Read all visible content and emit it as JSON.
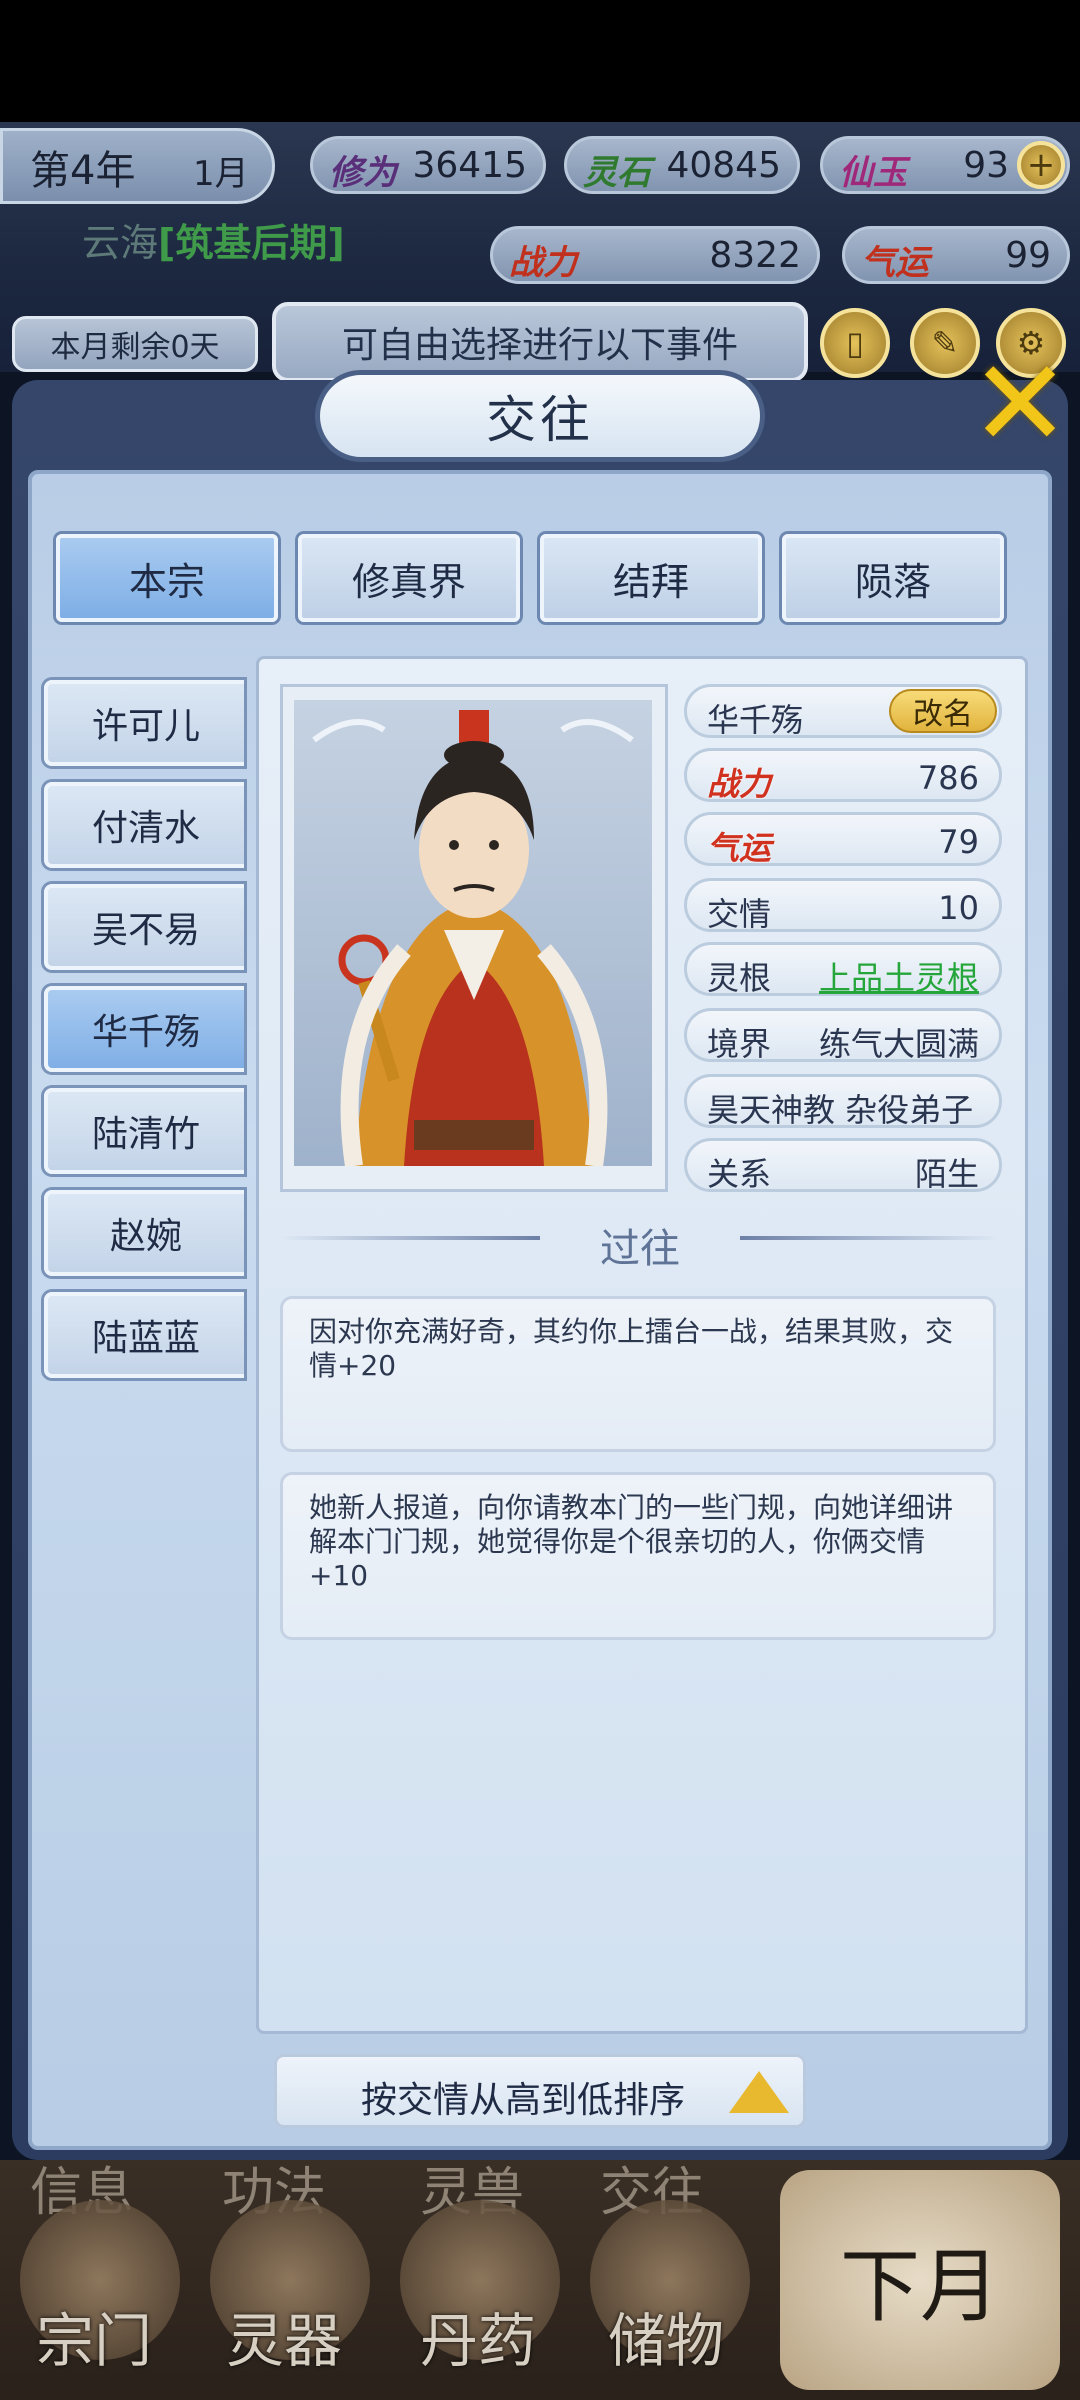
{
  "header": {
    "year": "第4年",
    "month": "1月",
    "stats": [
      {
        "label": "修为",
        "value": "36415",
        "color": "#5a2f7a"
      },
      {
        "label": "灵石",
        "value": "40845",
        "color": "#2f7a2f"
      },
      {
        "label": "仙玉",
        "value": "93",
        "color": "#a0287a"
      }
    ],
    "character_name": "云海",
    "realm": "[筑基后期]",
    "power_label": "战力",
    "power_value": "8322",
    "luck_label": "气运",
    "luck_value": "99",
    "remaining_days": "本月剩余0天",
    "event_prompt": "可自由选择进行以下事件"
  },
  "dialog": {
    "title": "交往",
    "tabs": [
      {
        "label": "本宗",
        "active": true
      },
      {
        "label": "修真界",
        "active": false
      },
      {
        "label": "结拜",
        "active": false
      },
      {
        "label": "陨落",
        "active": false
      }
    ],
    "names": [
      {
        "label": "许可儿",
        "active": false
      },
      {
        "label": "付清水",
        "active": false
      },
      {
        "label": "吴不易",
        "active": false
      },
      {
        "label": "华千殇",
        "active": true
      },
      {
        "label": "陆清竹",
        "active": false
      },
      {
        "label": "赵婉",
        "active": false
      },
      {
        "label": "陆蓝蓝",
        "active": false
      }
    ],
    "profile": {
      "name": "华千殇",
      "rename_label": "改名",
      "power_label": "战力",
      "power_value": "786",
      "luck_label": "气运",
      "luck_value": "79",
      "friendship_label": "交情",
      "friendship_value": "10",
      "root_label": "灵根",
      "root_value": "上品土灵根",
      "realm_label": "境界",
      "realm_value": "练气大圆满",
      "sect_title": "昊天神教 杂役弟子",
      "relation_label": "关系",
      "relation_value": "陌生"
    },
    "past_title": "过往",
    "history": [
      "因对你充满好奇，其约你上擂台一战，结果其败，交情+20",
      "她新人报道，向你请教本门的一些门规，向她详细讲解本门门规，她觉得你是个很亲切的人，你俩交情+10"
    ],
    "sort_label": "按交情从高到低排序"
  },
  "bottom_nav": {
    "ghost_labels": [
      "信息",
      "功法",
      "灵兽",
      "交往"
    ],
    "items": [
      "宗门",
      "灵器",
      "丹药",
      "储物"
    ],
    "next_month": "下月"
  },
  "colors": {
    "accent_gold": "#f2c519",
    "active_tab": "#80afe6",
    "red_stat": "#d0321f",
    "green_link": "#25a63a"
  }
}
